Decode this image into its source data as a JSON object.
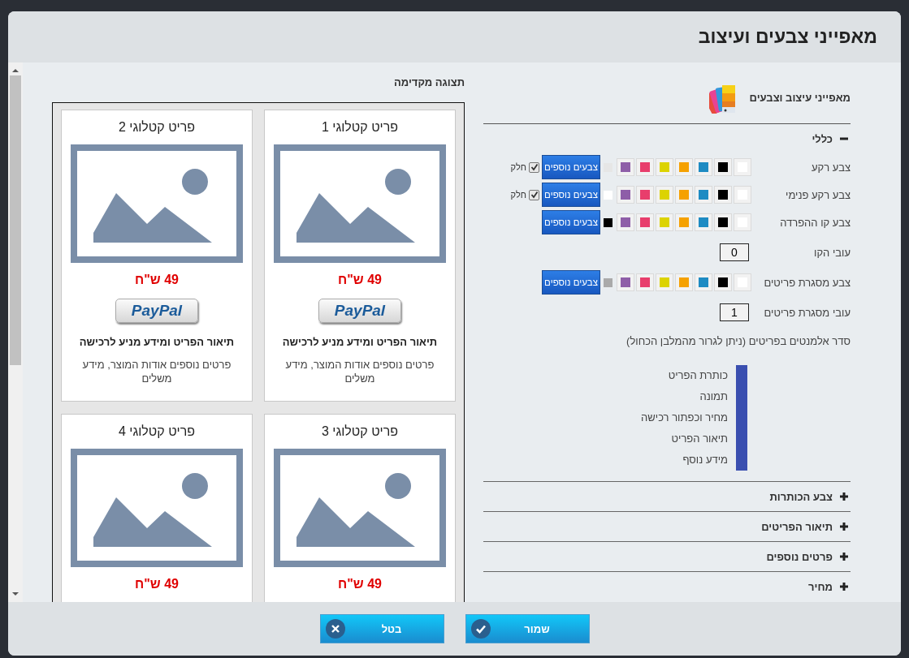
{
  "dialog": {
    "title": "מאפייני צבעים ועיצוב"
  },
  "preview": {
    "title": "תצוגה מקדימה",
    "items": [
      {
        "title": "פריט קטלוגי 1",
        "price": "49 ש\"ח",
        "paypal_label": "PayPal",
        "description": "תיאור הפריט ומידע מניע לרכישה",
        "details": "פרטים נוספים אודות המוצר, מידע משלים"
      },
      {
        "title": "פריט קטלוגי 2",
        "price": "49 ש\"ח",
        "paypal_label": "PayPal",
        "description": "תיאור הפריט ומידע מניע לרכישה",
        "details": "פרטים נוספים אודות המוצר, מידע משלים"
      },
      {
        "title": "פריט קטלוגי 3",
        "price": "49 ש\"ח"
      },
      {
        "title": "פריט קטלוגי 4",
        "price": "49 ש\"ח"
      }
    ]
  },
  "settings": {
    "heading": "מאפייני עיצוב וצבעים",
    "sections": [
      {
        "label": "כללי",
        "expanded": true,
        "rows": [
          {
            "kind": "color",
            "label": "צבע רקע",
            "palette": [
              {
                "color": "#ffffff"
              },
              {
                "color": "#000000"
              },
              {
                "color": "#1e8bc3"
              },
              {
                "color": "#f5a100"
              },
              {
                "color": "#dcd300"
              },
              {
                "color": "#e83e6c"
              },
              {
                "color": "#8e5ea8"
              }
            ],
            "current": {
              "color": "#e6e6e6"
            },
            "more_button": "צבעים נוספים",
            "transparent": {
              "label": "חלק",
              "checked": true
            }
          },
          {
            "kind": "color",
            "label": "צבע רקע פנימי",
            "palette": [
              {
                "color": "#ffffff"
              },
              {
                "color": "#000000"
              },
              {
                "color": "#1e8bc3"
              },
              {
                "color": "#f5a100"
              },
              {
                "color": "#dcd300"
              },
              {
                "color": "#e83e6c"
              },
              {
                "color": "#8e5ea8"
              }
            ],
            "current": {
              "color": "#ffffff"
            },
            "more_button": "צבעים נוספים",
            "transparent": {
              "label": "חלק",
              "checked": true
            }
          },
          {
            "kind": "color",
            "label": "צבע קו ההפרדה",
            "palette": [
              {
                "color": "#ffffff"
              },
              {
                "color": "#000000"
              },
              {
                "color": "#1e8bc3"
              },
              {
                "color": "#f5a100"
              },
              {
                "color": "#dcd300"
              },
              {
                "color": "#e83e6c"
              },
              {
                "color": "#8e5ea8"
              }
            ],
            "current": {
              "color": "#000000"
            },
            "more_button": "צבעים נוספים"
          },
          {
            "kind": "number",
            "label": "עובי הקו",
            "value": "0"
          },
          {
            "kind": "color",
            "label": "צבע מסגרת פריטים",
            "palette": [
              {
                "color": "#ffffff"
              },
              {
                "color": "#000000"
              },
              {
                "color": "#1e8bc3"
              },
              {
                "color": "#f5a100"
              },
              {
                "color": "#dcd300"
              },
              {
                "color": "#e83e6c"
              },
              {
                "color": "#8e5ea8"
              }
            ],
            "current": {
              "color": "#aaaaaa"
            },
            "more_button": "צבעים נוספים"
          },
          {
            "kind": "number",
            "label": "עובי מסגרת פריטים",
            "value": "1"
          },
          {
            "kind": "order",
            "label": "סדר אלמנטים בפריטים (ניתן לגרור מהמלבן הכחול)",
            "items": [
              "כותרת הפריט",
              "תמונה",
              "מחיר וכפתור רכישה",
              "תיאור הפריט",
              "מידע נוסף"
            ]
          }
        ]
      },
      {
        "label": "צבע הכותרות",
        "expanded": false
      },
      {
        "label": "תיאור הפריטים",
        "expanded": false
      },
      {
        "label": "פרטים נוספים",
        "expanded": false
      },
      {
        "label": "מחיר",
        "expanded": false
      }
    ]
  },
  "buttons": [
    {
      "kind": "save",
      "label": "שמור"
    },
    {
      "kind": "cancel",
      "label": "בטל"
    }
  ]
}
